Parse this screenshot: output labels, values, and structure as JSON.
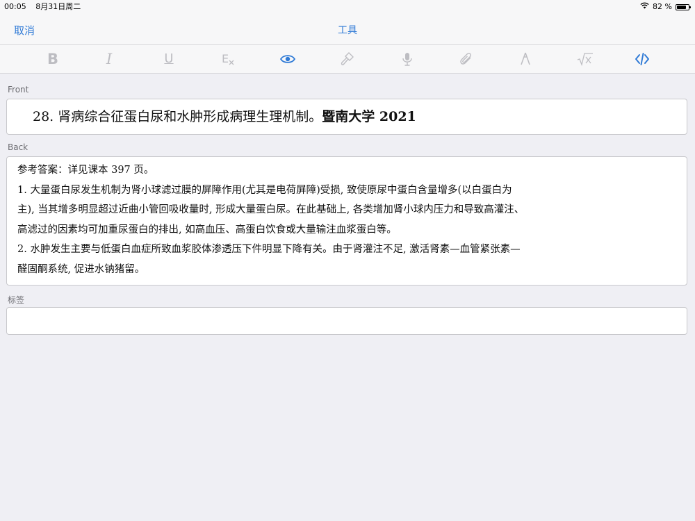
{
  "status_bar": {
    "time": "00:05",
    "date": "8月31日周二",
    "battery_percent": "82 %",
    "battery_level": 0.82
  },
  "nav": {
    "cancel_label": "取消",
    "title": "工具"
  },
  "toolbar": {
    "items": [
      {
        "name": "bold",
        "glyph": "B",
        "active": false
      },
      {
        "name": "italic",
        "glyph": "I",
        "active": false
      },
      {
        "name": "underline",
        "glyph": "U",
        "active": false
      },
      {
        "name": "clear-format",
        "glyph": "E",
        "active": false
      },
      {
        "name": "preview",
        "glyph": "eye-icon",
        "active": true
      },
      {
        "name": "brush",
        "glyph": "brush-icon",
        "active": false
      },
      {
        "name": "microphone",
        "glyph": "mic-icon",
        "active": false
      },
      {
        "name": "attachment",
        "glyph": "paperclip-icon",
        "active": false
      },
      {
        "name": "draw",
        "glyph": "pen-icon",
        "active": false
      },
      {
        "name": "math",
        "glyph": "sqrt-icon",
        "active": false
      },
      {
        "name": "html-editor",
        "glyph": "code-icon",
        "active": true
      }
    ],
    "active_color": "#2f7ad6",
    "inactive_color": "#bdbdc2"
  },
  "fields": {
    "front": {
      "label": "Front",
      "text_main": "28. 肾病综合征蛋白尿和水肿形成病理生理机制。",
      "text_bold": "暨南大学 2021"
    },
    "back": {
      "label": "Back",
      "lines": [
        "参考答案：详见课本 397 页。",
        "1. 大量蛋白尿发生机制为肾小球滤过膜的屏障作用(尤其是电荷屏障)受损, 致使原尿中蛋白含量增多(以白蛋白为",
        "主), 当其增多明显超过近曲小管回吸收量时, 形成大量蛋白尿。在此基础上, 各类增加肾小球内压力和导致高灌注、",
        "高滤过的因素均可加重尿蛋白的排出, 如高血压、高蛋白饮食或大量输注血浆蛋白等。",
        "2. 水肿发生主要与低蛋白血症所致血浆胶体渗透压下件明显下降有关。由于肾灌注不足, 激活肾素—血管紧张素—",
        "醛固酮系统, 促进水钠猪留。"
      ]
    },
    "tags": {
      "label": "标签",
      "value": ""
    }
  }
}
